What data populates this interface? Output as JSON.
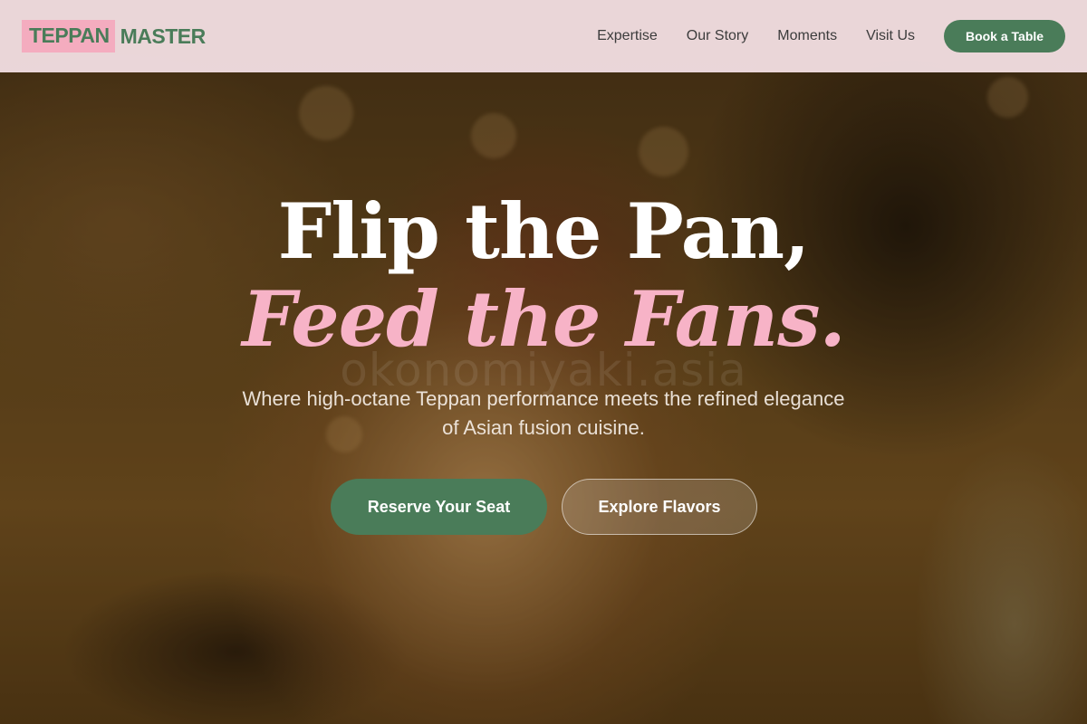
{
  "header": {
    "brand_part1": "TEPPAN",
    "brand_part2": "MASTER",
    "nav": [
      "Expertise",
      "Our Story",
      "Moments",
      "Visit Us"
    ],
    "cta_label": "Book a Table"
  },
  "hero": {
    "title_line1": "Flip the Pan,",
    "title_line2": "Feed the Fans.",
    "subtitle": "Where high-octane Teppan performance meets the refined elegance of Asian fusion cuisine.",
    "primary_button": "Reserve Your Seat",
    "secondary_button": "Explore Flavors",
    "watermark": "okonomiyaki.asia",
    "background_image": "blurred-food-photo"
  },
  "colors": {
    "brand_green": "#4a7c59",
    "brand_pink": "#f4acbf",
    "accent_pink_text": "#f7b3c7",
    "header_bg": "#f3dfe4"
  }
}
